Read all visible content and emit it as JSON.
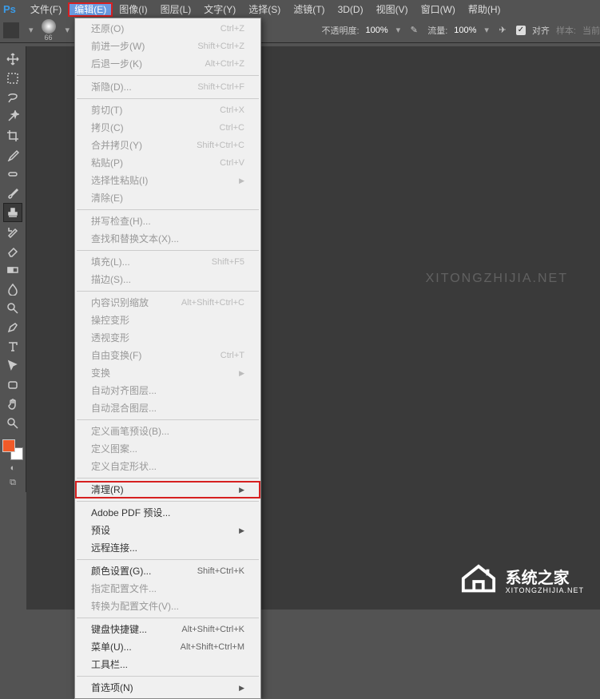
{
  "menubar": {
    "items": [
      "文件(F)",
      "编辑(E)",
      "图像(I)",
      "图层(L)",
      "文字(Y)",
      "选择(S)",
      "滤镜(T)",
      "3D(D)",
      "视图(V)",
      "窗口(W)",
      "帮助(H)"
    ],
    "active_index": 1
  },
  "optionbar": {
    "brush_size": "66",
    "opacity_label": "不透明度:",
    "opacity_value": "100%",
    "flow_label": "流量:",
    "flow_value": "100%",
    "align_label": "对齐",
    "sample_label": "样本:",
    "sample_value": "当前"
  },
  "toolbox": {
    "tools": [
      "move",
      "marquee",
      "lasso",
      "magic-wand",
      "crop",
      "eyedropper",
      "healing",
      "brush",
      "stamp",
      "history-brush",
      "eraser",
      "gradient",
      "blur",
      "dodge",
      "pen",
      "type",
      "path-select",
      "rectangle",
      "hand",
      "zoom"
    ],
    "active_index": 8
  },
  "dropdown": {
    "groups": [
      [
        {
          "label": "还原(O)",
          "shortcut": "Ctrl+Z",
          "disabled": true
        },
        {
          "label": "前进一步(W)",
          "shortcut": "Shift+Ctrl+Z",
          "disabled": true
        },
        {
          "label": "后退一步(K)",
          "shortcut": "Alt+Ctrl+Z",
          "disabled": true
        }
      ],
      [
        {
          "label": "渐隐(D)...",
          "shortcut": "Shift+Ctrl+F",
          "disabled": true
        }
      ],
      [
        {
          "label": "剪切(T)",
          "shortcut": "Ctrl+X",
          "disabled": true
        },
        {
          "label": "拷贝(C)",
          "shortcut": "Ctrl+C",
          "disabled": true
        },
        {
          "label": "合并拷贝(Y)",
          "shortcut": "Shift+Ctrl+C",
          "disabled": true
        },
        {
          "label": "粘贴(P)",
          "shortcut": "Ctrl+V",
          "disabled": true
        },
        {
          "label": "选择性粘贴(I)",
          "submenu": true,
          "disabled": true
        },
        {
          "label": "清除(E)",
          "disabled": true
        }
      ],
      [
        {
          "label": "拼写检查(H)...",
          "disabled": true
        },
        {
          "label": "查找和替换文本(X)...",
          "disabled": true
        }
      ],
      [
        {
          "label": "填充(L)...",
          "shortcut": "Shift+F5",
          "disabled": true
        },
        {
          "label": "描边(S)...",
          "disabled": true
        }
      ],
      [
        {
          "label": "内容识别缩放",
          "shortcut": "Alt+Shift+Ctrl+C",
          "disabled": true
        },
        {
          "label": "操控变形",
          "disabled": true
        },
        {
          "label": "透视变形",
          "disabled": true
        },
        {
          "label": "自由变换(F)",
          "shortcut": "Ctrl+T",
          "disabled": true
        },
        {
          "label": "变换",
          "submenu": true,
          "disabled": true
        },
        {
          "label": "自动对齐图层...",
          "disabled": true
        },
        {
          "label": "自动混合图层...",
          "disabled": true
        }
      ],
      [
        {
          "label": "定义画笔预设(B)...",
          "disabled": true
        },
        {
          "label": "定义图案...",
          "disabled": true
        },
        {
          "label": "定义自定形状...",
          "disabled": true
        }
      ],
      [
        {
          "label": "清理(R)",
          "submenu": true,
          "highlight": true
        }
      ],
      [
        {
          "label": "Adobe PDF 预设..."
        },
        {
          "label": "预设",
          "submenu": true
        },
        {
          "label": "远程连接..."
        }
      ],
      [
        {
          "label": "颜色设置(G)...",
          "shortcut": "Shift+Ctrl+K"
        },
        {
          "label": "指定配置文件...",
          "disabled": true
        },
        {
          "label": "转换为配置文件(V)...",
          "disabled": true
        }
      ],
      [
        {
          "label": "键盘快捷键...",
          "shortcut": "Alt+Shift+Ctrl+K"
        },
        {
          "label": "菜单(U)...",
          "shortcut": "Alt+Shift+Ctrl+M"
        },
        {
          "label": "工具栏..."
        }
      ],
      [
        {
          "label": "首选项(N)",
          "submenu": true
        }
      ]
    ]
  },
  "watermark": {
    "text1": "XITONGZHIJIA.NET",
    "text2_main": "系统之家",
    "text2_sub": "XITONGZHIJIA.NET"
  }
}
